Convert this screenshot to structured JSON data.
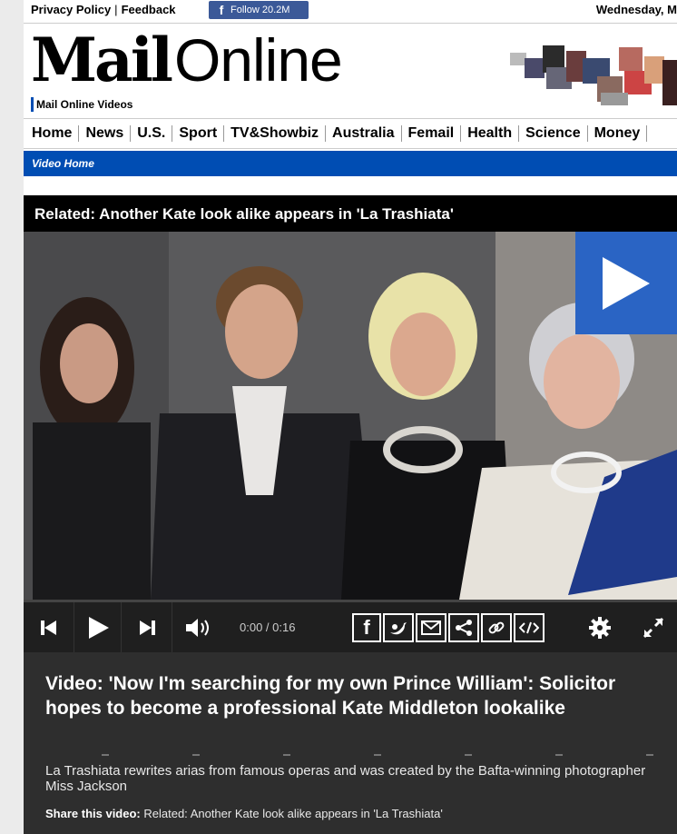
{
  "topbar": {
    "privacy": "Privacy Policy",
    "feedback": "Feedback",
    "fb_icon": "f",
    "follow": "Follow 20.2M",
    "date": "Wednesday, M"
  },
  "logo": {
    "mail": "Mail",
    "online": "Online",
    "subbrand": "Mail Online Videos"
  },
  "nav": [
    "Home",
    "News",
    "U.S.",
    "Sport",
    "TV&Showbiz",
    "Australia",
    "Femail",
    "Health",
    "Science",
    "Money"
  ],
  "subnav": {
    "label": "Video Home"
  },
  "player": {
    "related_title": "Related: Another Kate look alike appears in 'La Trashiata'",
    "time": "0:00 / 0:16",
    "accent": "#2a64c4"
  },
  "caption": {
    "title": "Video: 'Now I'm searching for my own Prince William': Solicitor hopes to become a professional Kate Middleton lookalike",
    "description": "La Trashiata rewrites arias from famous operas and was created by the Bafta-winning photographer Miss Jackson",
    "share_label": "Share this video:",
    "share_text": "Related: Another Kate look alike appears in 'La Trashiata'"
  }
}
